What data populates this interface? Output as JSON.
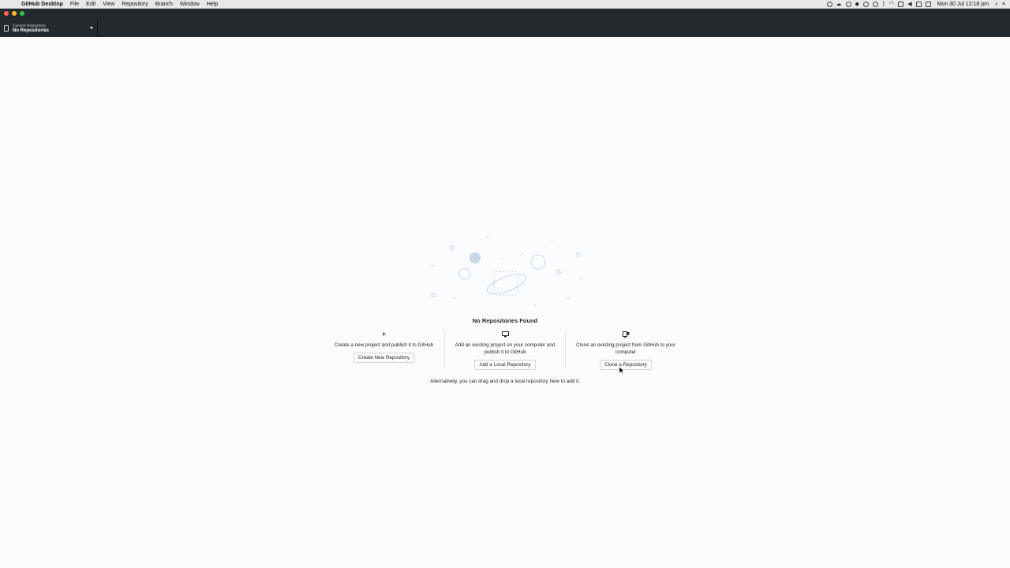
{
  "menubar": {
    "app_name": "GitHub Desktop",
    "items": [
      "File",
      "Edit",
      "View",
      "Repository",
      "Branch",
      "Window",
      "Help"
    ],
    "clock": "Mon 30 Jul  12:18 pm"
  },
  "toolbar": {
    "repo_caption": "Current Repository",
    "repo_name": "No Repositories"
  },
  "blank_slate": {
    "title": "No Repositories Found",
    "actions": [
      {
        "icon": "plus-icon",
        "description": "Create a new project and publish it to GitHub",
        "button": "Create New Repository"
      },
      {
        "icon": "desktop-icon",
        "description": "Add an existing project on your computer and publish it to GitHub",
        "button": "Add a Local Repository"
      },
      {
        "icon": "repo-clone-icon",
        "description": "Clone an existing project from GitHub to your computer",
        "button": "Clone a Repository"
      }
    ],
    "alternative": "Alternatively, you can drag and drop a local repository here to add it."
  },
  "colors": {
    "toolbar_bg": "#24292e",
    "page_bg": "#fafbfc",
    "illustration": "#c8d6ea"
  }
}
